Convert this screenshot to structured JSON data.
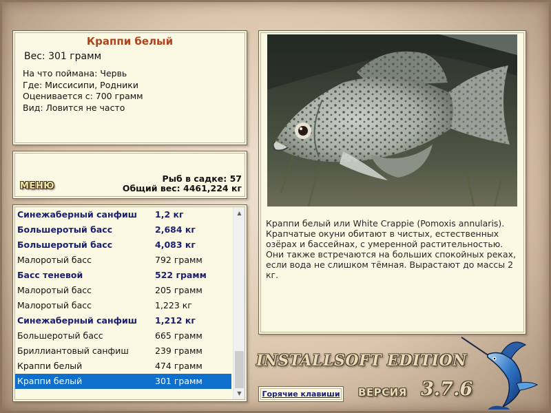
{
  "info": {
    "title": "Краппи белый",
    "weight": "Вес: 301 грамм",
    "caught_with": "На что поймана: Червь",
    "location": "Где: Миссисипи, Родники",
    "value_from": "Оценивается с: 700 грамм",
    "kind": "Вид: Ловится не часто"
  },
  "menu": {
    "label": "МЕНЮ"
  },
  "stats": {
    "fish_in_cage": "Рыб в садке: 57",
    "total_weight": "Общий вес: 4461,224 кг"
  },
  "catch_list": [
    {
      "name": "Синежаберный санфиш",
      "weight": "1,2 кг",
      "bold": true
    },
    {
      "name": "Большеротый басс",
      "weight": "2,684 кг",
      "bold": true
    },
    {
      "name": "Большеротый басс",
      "weight": "4,083 кг",
      "bold": true
    },
    {
      "name": "Малоротый басс",
      "weight": "792 грамм",
      "bold": false
    },
    {
      "name": "Басс теневой",
      "weight": "522 грамм",
      "bold": true
    },
    {
      "name": "Малоротый басс",
      "weight": "205 грамм",
      "bold": false
    },
    {
      "name": "Малоротый басс",
      "weight": "1,223 кг",
      "bold": false
    },
    {
      "name": "Синежаберный санфиш",
      "weight": "1,212 кг",
      "bold": true
    },
    {
      "name": "Большеротый басс",
      "weight": "665 грамм",
      "bold": false
    },
    {
      "name": "Бриллиантовый санфиш",
      "weight": "239 грамм",
      "bold": false
    },
    {
      "name": "Краппи белый",
      "weight": "474 грамм",
      "bold": false
    },
    {
      "name": "Краппи белый",
      "weight": "301 грамм",
      "bold": false,
      "selected": true
    }
  ],
  "description": "Краппи белый или White Crappie (Pomoxis annularis). Крапчатые окуни обитают в чистых, естественных озёрах и бассейнах, с умеренной растительностью. Они также встречаются на больших спокойных реках, если вода не слишком тёмная. Вырастают до массы 2 кг.",
  "branding": {
    "edition": "INSTALLSOFT EDITION",
    "version_label": "ВЕРСИЯ",
    "version_number": "3.7.6"
  },
  "hotkeys": {
    "label": "Горячие клавиши"
  },
  "icons": {
    "logo": "marlin-logo-icon",
    "photo": "white-crappie-photo",
    "menu": "menu-button"
  },
  "colors": {
    "accent_title": "#b0431b",
    "list_bold": "#1a1f72",
    "selection": "#0f6fcd",
    "panel_bg": "#fbf9e3"
  }
}
